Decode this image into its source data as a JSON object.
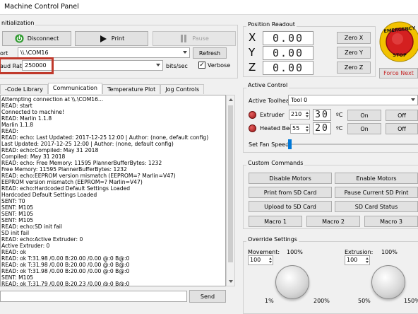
{
  "window": {
    "title": "Machine Control Panel"
  },
  "initialization": {
    "title": "nitialization",
    "disconnect_label": "Disconnect",
    "print_label": "Print",
    "pause_label": "Pause",
    "port_label": "ort",
    "port_value": "\\\\.\\COM16",
    "refresh_label": "Refresh",
    "baud_label": "aud Rate",
    "baud_value": "250000",
    "bits_label": "bits/sec",
    "verbose_label": "Verbose",
    "highlight_color": "#c0392b"
  },
  "tabs": [
    "-Code Library",
    "Communication",
    "Temperature Plot",
    "Jog Controls"
  ],
  "log_lines": [
    "Attempting connection at \\\\.\\COM16...",
    "READ: start",
    "  Connected to machine!",
    "READ: Marlin 1.1.8",
    "Marlin 1.1.8",
    "READ:",
    "READ: echo: Last Updated: 2017-12-25 12:00 | Author: (none, default config)",
    "Last Updated: 2017-12-25 12:00 | Author: (none, default config)",
    "READ: echo:Compiled: May 31 2018",
    "Compiled: May 31 2018",
    "READ: echo: Free Memory: 11595  PlannerBufferBytes: 1232",
    "Free Memory: 11595  PlannerBufferBytes: 1232",
    "READ: echo:EEPROM version mismatch (EEPROM=? Marlin=V47)",
    "EEPROM version mismatch (EEPROM=? Marlin=V47)",
    "READ: echo:Hardcoded Default Settings Loaded",
    "Hardcoded Default Settings Loaded",
    "SENT: T0",
    "SENT: M105",
    "SENT: M105",
    "SENT: M105",
    "READ: echo:SD init fail",
    "SD init fail",
    "READ: echo:Active Extruder: 0",
    "Active Extruder: 0",
    "READ: ok",
    "READ: ok T:31.98 /0.00 B:20.00 /0.00 @:0 B@:0",
    "READ: ok T:31.98 /0.00 B:20.00 /0.00 @:0 B@:0",
    "READ: ok T:31.98 /0.00 B:20.00 /0.00 @:0 B@:0",
    "SENT: M105",
    "READ: ok T:31.79 /0.00 B:20.23 /0.00 @:0 B@:0"
  ],
  "command_input": {
    "value": ""
  },
  "send_label": "Send",
  "position": {
    "title": "Position Readout",
    "axes": [
      {
        "axis": "X",
        "value": "0.00",
        "zero_label": "Zero X"
      },
      {
        "axis": "Y",
        "value": "0.00",
        "zero_label": "Zero Y"
      },
      {
        "axis": "Z",
        "value": "0.00",
        "zero_label": "Zero Z"
      }
    ]
  },
  "emergency": {
    "line1": "EMERGENCY",
    "line2": "STOP",
    "force_next_label": "Force Next",
    "color": "#d42020",
    "ring_color": "#f2c200"
  },
  "active_control": {
    "title": "Active Control",
    "toolhead_label": "Active Toolhead",
    "toolhead_value": "Tool 0",
    "extruder_label": "Extruder",
    "extruder_target": "210",
    "extruder_current": "30",
    "heated_bed_label": "Heated Bed",
    "bed_target": "55",
    "bed_current": "20",
    "unit": "ºC",
    "on_label": "On",
    "off_label": "Off",
    "fan_label": "Set Fan Speed",
    "fan_level": 0.02
  },
  "custom_commands": {
    "title": "Custom Commands",
    "buttons": [
      "Disable Motors",
      "Enable Motors",
      "Print from SD Card",
      "Pause Current SD Print",
      "Upload to SD Card",
      "SD Card Status",
      "Macro 1",
      "Macro 2",
      "Macro 3"
    ]
  },
  "override": {
    "title": "Override Settings",
    "movement_label": "Movement:",
    "movement_value": "100",
    "extrusion_label": "Extrusion:",
    "extrusion_value": "100",
    "pct_100": "100%",
    "movement_min": "1%",
    "movement_max": "200%",
    "extrusion_min": "50%",
    "extrusion_max": "150%"
  }
}
